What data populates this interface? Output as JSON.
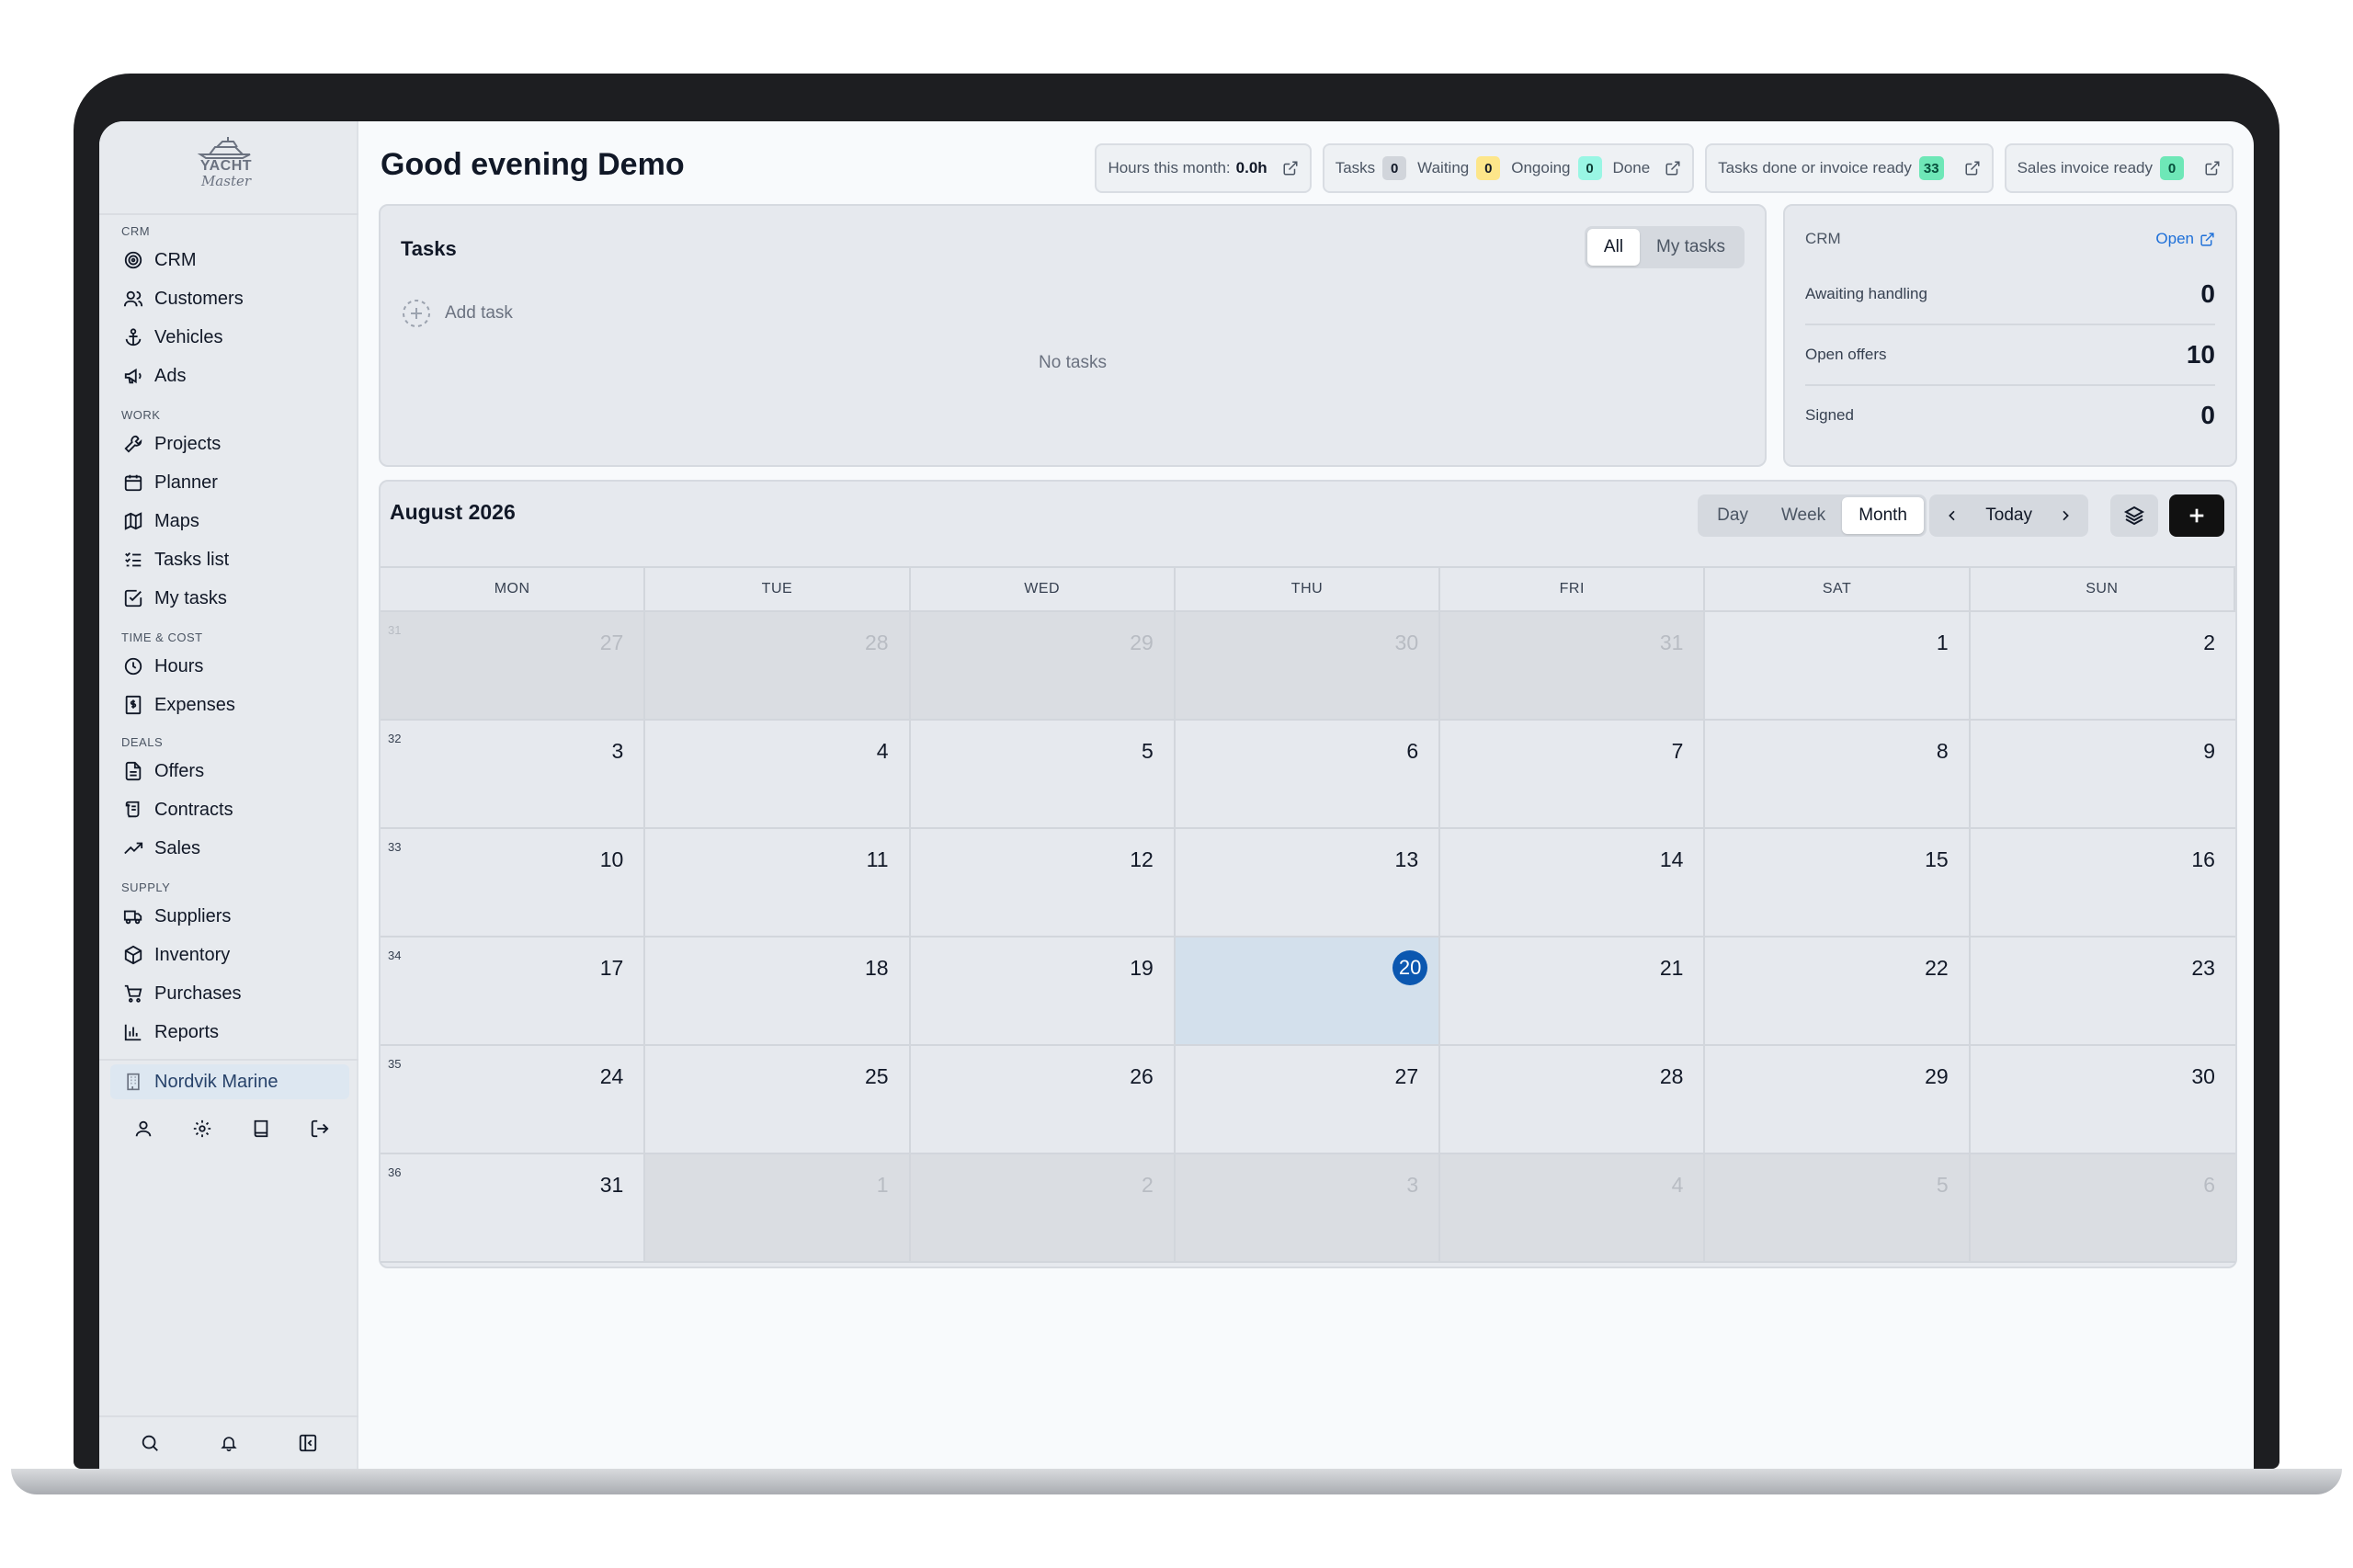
{
  "brand": {
    "line1": "YACHT",
    "line2": "Master"
  },
  "sidebar": {
    "sections": [
      {
        "title": "CRM",
        "items": [
          {
            "label": "CRM",
            "icon": "target-icon"
          },
          {
            "label": "Customers",
            "icon": "users-icon"
          },
          {
            "label": "Vehicles",
            "icon": "anchor-icon"
          },
          {
            "label": "Ads",
            "icon": "megaphone-icon"
          }
        ]
      },
      {
        "title": "WORK",
        "items": [
          {
            "label": "Projects",
            "icon": "wrench-icon"
          },
          {
            "label": "Planner",
            "icon": "calendar-icon"
          },
          {
            "label": "Maps",
            "icon": "map-icon"
          },
          {
            "label": "Tasks list",
            "icon": "list-checks-icon"
          },
          {
            "label": "My tasks",
            "icon": "check-square-icon"
          }
        ]
      },
      {
        "title": "TIME & COST",
        "items": [
          {
            "label": "Hours",
            "icon": "clock-icon"
          },
          {
            "label": "Expenses",
            "icon": "receipt-icon"
          }
        ]
      },
      {
        "title": "DEALS",
        "items": [
          {
            "label": "Offers",
            "icon": "document-icon"
          },
          {
            "label": "Contracts",
            "icon": "scroll-icon"
          },
          {
            "label": "Sales",
            "icon": "trending-up-icon"
          }
        ]
      },
      {
        "title": "SUPPLY",
        "items": [
          {
            "label": "Suppliers",
            "icon": "truck-icon"
          },
          {
            "label": "Inventory",
            "icon": "package-icon"
          },
          {
            "label": "Purchases",
            "icon": "cart-icon"
          },
          {
            "label": "Reports",
            "icon": "bar-chart-icon"
          }
        ]
      }
    ],
    "company": "Nordvik Marine"
  },
  "greeting": "Good evening Demo",
  "stats": {
    "hours_label": "Hours this month:",
    "hours_value": "0.0h",
    "tasks_label": "Tasks",
    "tasks_count": "0",
    "waiting_label": "Waiting",
    "waiting_count": "0",
    "ongoing_label": "Ongoing",
    "ongoing_count": "0",
    "done_label": "Done",
    "invoice_ready_label": "Tasks done or invoice ready",
    "invoice_ready_count": "33",
    "sales_ready_label": "Sales invoice ready",
    "sales_ready_count": "0"
  },
  "tasks": {
    "title": "Tasks",
    "filters": [
      "All",
      "My tasks"
    ],
    "active_filter": "All",
    "add_label": "Add task",
    "empty_label": "No tasks"
  },
  "crm": {
    "title": "CRM",
    "open_label": "Open",
    "rows": [
      {
        "label": "Awaiting handling",
        "value": "0"
      },
      {
        "label": "Open offers",
        "value": "10"
      },
      {
        "label": "Signed",
        "value": "0"
      }
    ]
  },
  "calendar": {
    "title": "August 2026",
    "views": [
      "Day",
      "Week",
      "Month"
    ],
    "active_view": "Month",
    "today_label": "Today",
    "days_of_week": [
      "MON",
      "TUE",
      "WED",
      "THU",
      "FRI",
      "SAT",
      "SUN"
    ],
    "weeks": [
      {
        "week": "31",
        "days": [
          {
            "d": "27",
            "out": true
          },
          {
            "d": "28",
            "out": true
          },
          {
            "d": "29",
            "out": true
          },
          {
            "d": "30",
            "out": true
          },
          {
            "d": "31",
            "out": true
          },
          {
            "d": "1"
          },
          {
            "d": "2"
          }
        ]
      },
      {
        "week": "32",
        "days": [
          {
            "d": "3"
          },
          {
            "d": "4"
          },
          {
            "d": "5"
          },
          {
            "d": "6"
          },
          {
            "d": "7"
          },
          {
            "d": "8"
          },
          {
            "d": "9"
          }
        ]
      },
      {
        "week": "33",
        "days": [
          {
            "d": "10"
          },
          {
            "d": "11"
          },
          {
            "d": "12"
          },
          {
            "d": "13"
          },
          {
            "d": "14"
          },
          {
            "d": "15"
          },
          {
            "d": "16"
          }
        ]
      },
      {
        "week": "34",
        "days": [
          {
            "d": "17"
          },
          {
            "d": "18"
          },
          {
            "d": "19"
          },
          {
            "d": "20",
            "today": true
          },
          {
            "d": "21"
          },
          {
            "d": "22"
          },
          {
            "d": "23"
          }
        ]
      },
      {
        "week": "35",
        "days": [
          {
            "d": "24"
          },
          {
            "d": "25"
          },
          {
            "d": "26"
          },
          {
            "d": "27"
          },
          {
            "d": "28"
          },
          {
            "d": "29"
          },
          {
            "d": "30"
          }
        ]
      },
      {
        "week": "36",
        "days": [
          {
            "d": "31"
          },
          {
            "d": "1",
            "out": true
          },
          {
            "d": "2",
            "out": true
          },
          {
            "d": "3",
            "out": true
          },
          {
            "d": "4",
            "out": true
          },
          {
            "d": "5",
            "out": true
          },
          {
            "d": "6",
            "out": true
          }
        ]
      }
    ]
  },
  "colors": {
    "accent": "#0b57b0",
    "link": "#1d6fd8"
  }
}
